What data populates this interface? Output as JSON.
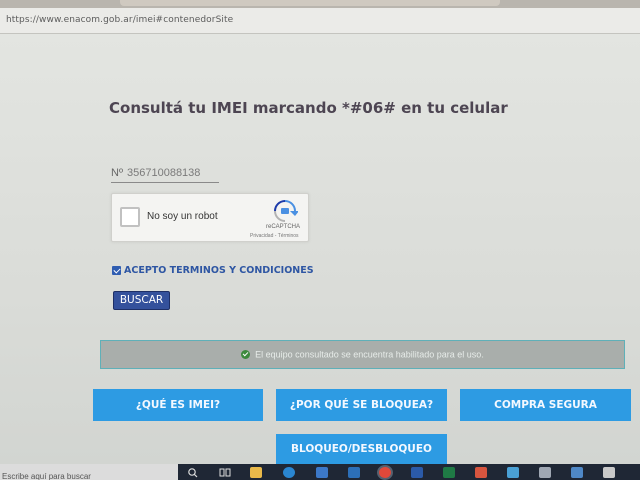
{
  "browser": {
    "url": "https://www.enacom.gob.ar/imei#contenedorSite"
  },
  "form": {
    "heading": "Consultá tu IMEI marcando *#06# en tu celular",
    "imei_prefix": "Nº",
    "imei_value": "356710088138",
    "captcha": {
      "label": "No soy un robot",
      "brand": "reCAPTCHA",
      "links": "Privacidad - Términos"
    },
    "terms_checked": true,
    "terms_label": "ACEPTO TERMINOS Y CONDICIONES",
    "search_button": "BUSCAR"
  },
  "status": {
    "message": "El equipo consultado se encuentra habilitado para el uso.",
    "icon": "check-circle-icon",
    "color": "#3d8a3d"
  },
  "nav": {
    "what_is_imei": "¿QUÉ ES IMEI?",
    "why_blocked": "¿POR QUÉ SE BLOQUEA?",
    "safe_purchase": "COMPRA SEGURA",
    "block_unblock": "BLOQUEO/DESBLOQUEO"
  },
  "taskbar": {
    "search_placeholder": "Escribe aquí para buscar",
    "icons": [
      "search-icon",
      "task-view-icon",
      "file-explorer-icon",
      "edge-icon",
      "store-icon",
      "mail-icon",
      "chrome-icon",
      "word-icon",
      "excel-icon",
      "teams-icon",
      "app-icon",
      "app-icon",
      "app-icon",
      "app-icon"
    ]
  },
  "colors": {
    "brand_blue": "#2d9be3",
    "button_dark_blue": "#34519c",
    "terms_blue": "#2e56a3",
    "heading": "#4d4552"
  }
}
